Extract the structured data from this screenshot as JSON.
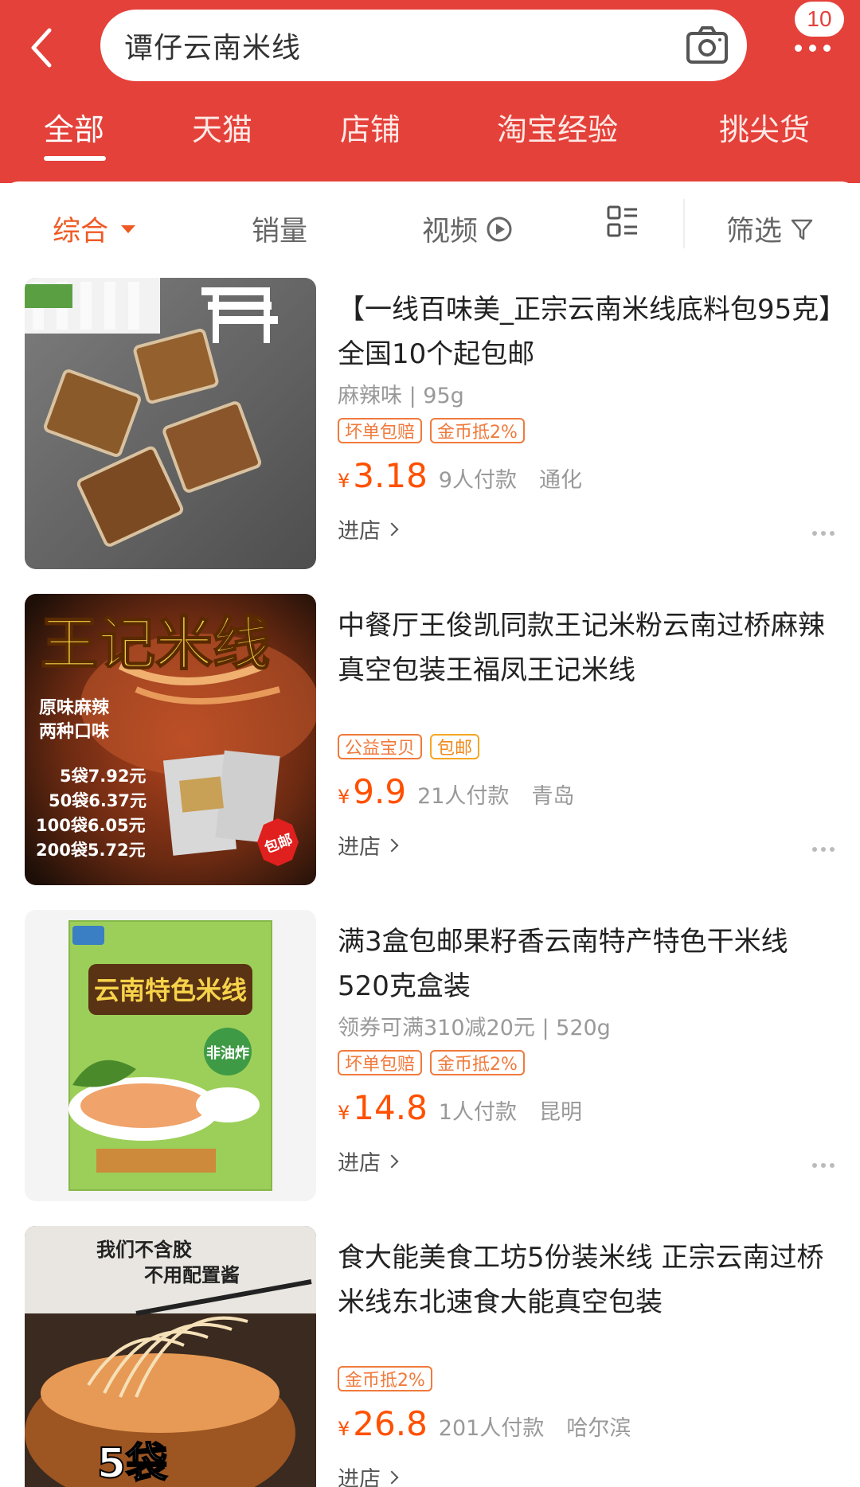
{
  "header": {
    "search_text": "谭仔云南米线",
    "notification_count": "10",
    "back_icon": "chevron-left-icon",
    "camera_icon": "camera-icon",
    "more_icon": "more-horizontal-icon",
    "bg_color": "#e4413a"
  },
  "tabs": [
    {
      "label": "全部",
      "active": true
    },
    {
      "label": "天猫"
    },
    {
      "label": "店铺"
    },
    {
      "label": "淘宝经验"
    },
    {
      "label": "挑尖货"
    }
  ],
  "sortbar": {
    "comprehensive": "综合",
    "sales": "销量",
    "video": "视频",
    "filter": "筛选",
    "accent_color": "#ee5a24"
  },
  "products": [
    {
      "title": "【一线百味美_正宗云南米线底料包95克】全国10个起包邮",
      "sub": "麻辣味 | 95g",
      "tags": [
        "坏单包赔",
        "金币抵2%"
      ],
      "price_symbol": "¥",
      "price": "3.18",
      "sales": "9人付款",
      "location": "通化",
      "shop_link": "进店"
    },
    {
      "title": "中餐厅王俊凯同款王记米粉云南过桥麻辣真空包装王福凤王记米线",
      "sub": "",
      "tags": [
        "公益宝贝",
        "包邮"
      ],
      "price_symbol": "¥",
      "price": "9.9",
      "sales": "21人付款",
      "location": "青岛",
      "shop_link": "进店",
      "image_text": {
        "brand": "王记米线",
        "flavor1": "原味麻辣",
        "flavor2": "两种口味",
        "tier1": "5袋7.92元",
        "tier2": "50袋6.37元",
        "tier3": "100袋6.05元",
        "tier4": "200袋5.72元",
        "badge": "包邮"
      }
    },
    {
      "title": "满3盒包邮果籽香云南特产特色干米线520克盒装",
      "sub": "领券可满310减20元 | 520g",
      "tags": [
        "坏单包赔",
        "金币抵2%"
      ],
      "price_symbol": "¥",
      "price": "14.8",
      "sales": "1人付款",
      "location": "昆明",
      "shop_link": "进店",
      "image_text": {
        "brand": "云南特色米线",
        "sub": "非油炸"
      }
    },
    {
      "title": "食大能美食工坊5份装米线 正宗云南过桥米线东北速食大能真空包装",
      "sub": "",
      "tags": [
        "金币抵2%"
      ],
      "price_symbol": "¥",
      "price": "26.8",
      "sales": "201人付款",
      "location": "哈尔滨",
      "shop_link": "进店",
      "image_text": {
        "line1": "我们不含胶",
        "line2": "不用配置酱",
        "count": "5袋"
      }
    }
  ]
}
